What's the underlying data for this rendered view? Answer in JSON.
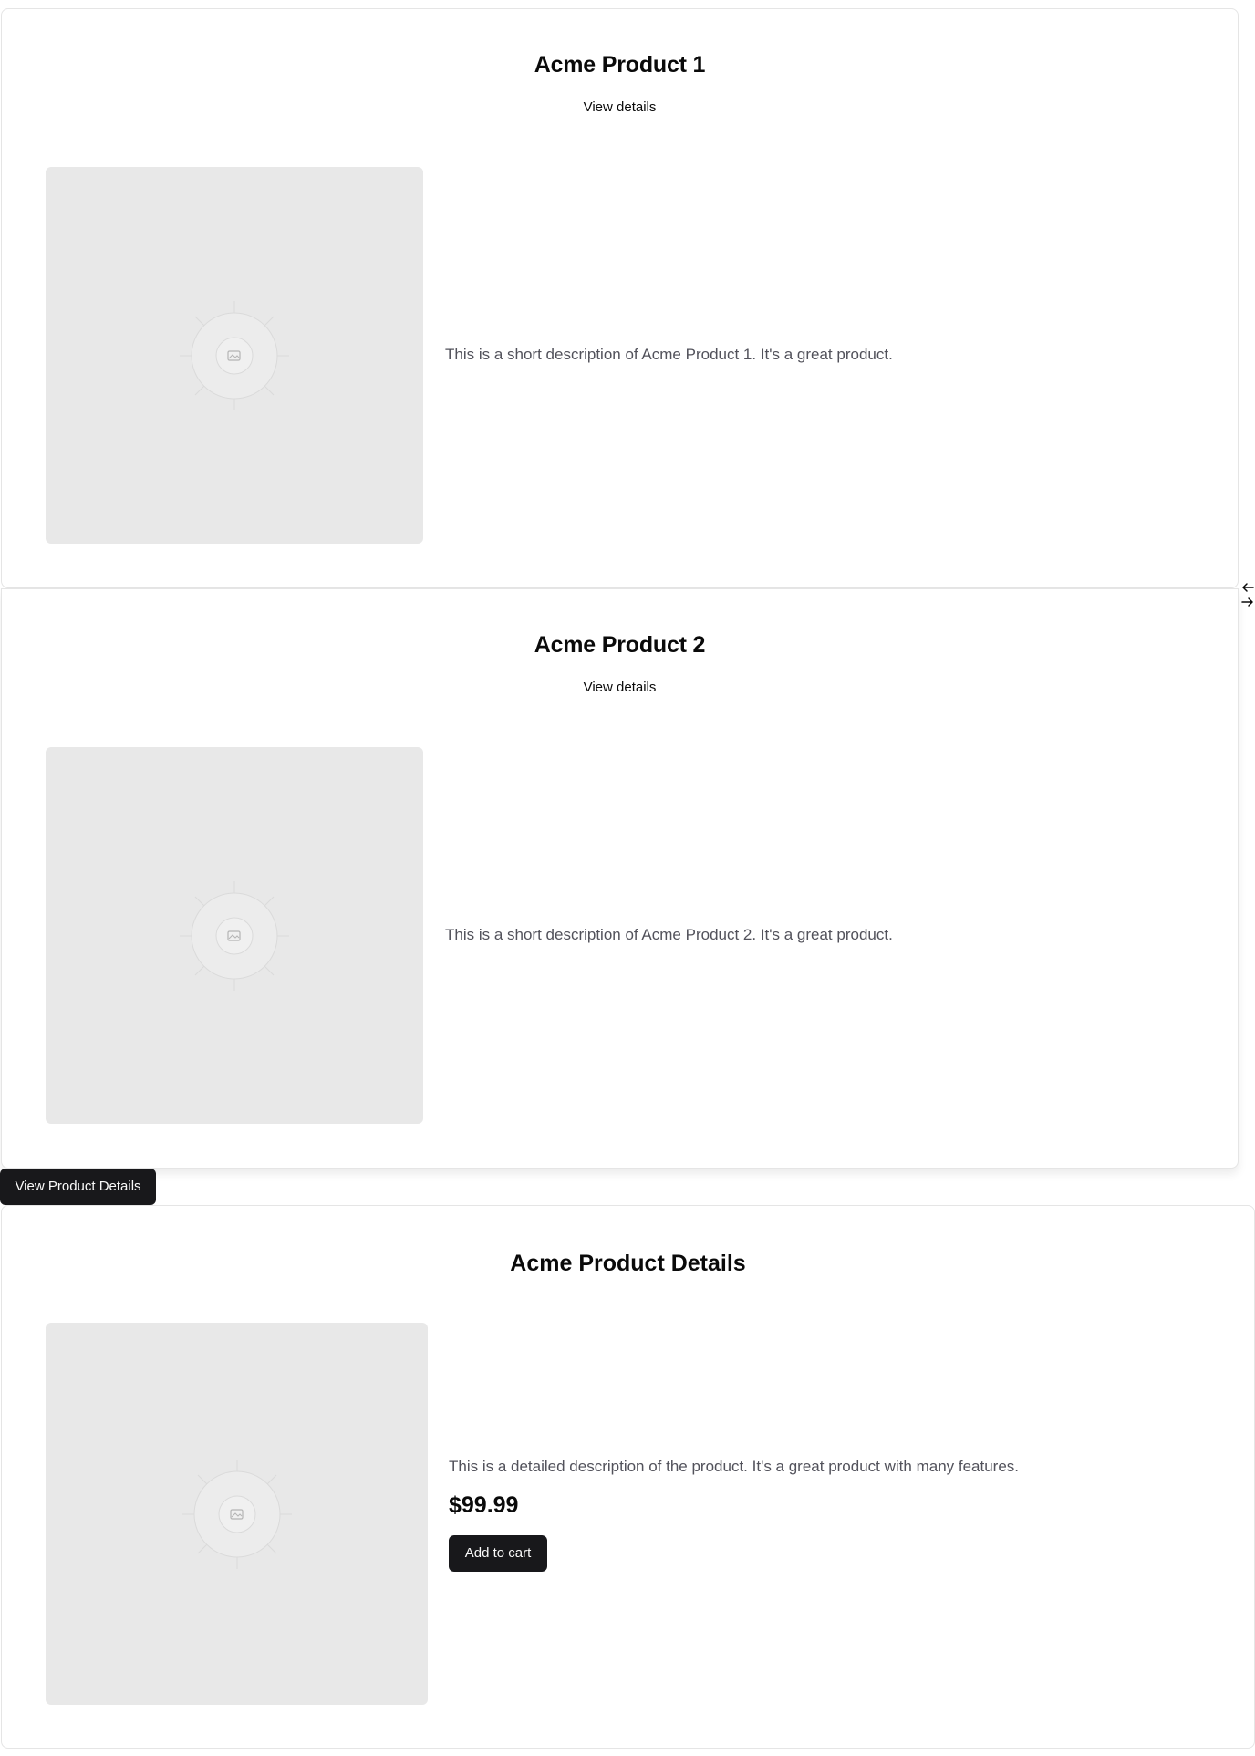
{
  "carousel": {
    "products": [
      {
        "title": "Acme Product 1",
        "link_label": "View details",
        "description": "This is a short description of Acme Product 1. It's a great product.",
        "image_icon": "image-placeholder-icon"
      },
      {
        "title": "Acme Product 2",
        "link_label": "View details",
        "description": "This is a short description of Acme Product 2. It's a great product.",
        "image_icon": "image-placeholder-icon"
      }
    ],
    "prev_icon": "arrow-left-icon",
    "next_icon": "arrow-right-icon"
  },
  "view_button_label": "View Product Details",
  "details": {
    "title": "Acme Product Details",
    "description": "This is a detailed description of the product. It's a great product with many features.",
    "price": "$99.99",
    "add_to_cart_label": "Add to cart",
    "image_icon": "image-placeholder-icon"
  },
  "colors": {
    "button_bg": "#18181b",
    "button_text": "#fafafa",
    "placeholder_bg": "#e8e8e8",
    "muted_text": "#52525b",
    "border": "#e5e5e5"
  }
}
